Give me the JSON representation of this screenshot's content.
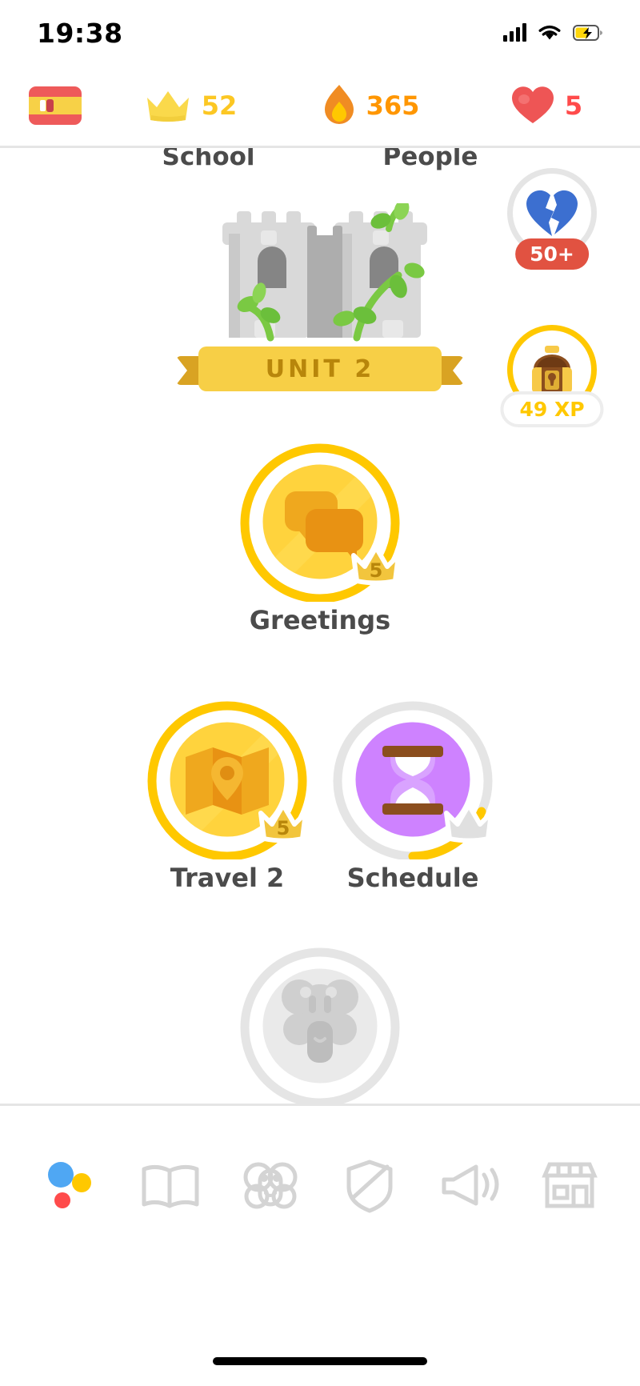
{
  "status_bar": {
    "time": "19:38",
    "icons": [
      "cellular-signal-icon",
      "wifi-icon",
      "battery-charging-icon"
    ]
  },
  "top_bar": {
    "course_flag": {
      "name": "spanish-flag-icon",
      "language": "Spanish"
    },
    "crown": {
      "icon": "crown-icon",
      "value": "52",
      "color": "#FCC723"
    },
    "streak": {
      "icon": "flame-icon",
      "value": "365",
      "color": "#FF9600"
    },
    "hearts": {
      "icon": "heart-icon",
      "value": "5",
      "color": "#FF4B4B"
    }
  },
  "tabs_cut_off": [
    {
      "label": "School"
    },
    {
      "label": "People"
    }
  ],
  "unit_header": {
    "illustration": "castle-icon",
    "banner_label": "UNIT 2"
  },
  "right_rail": [
    {
      "name": "streak-repair-button",
      "icon": "broken-heart-icon",
      "icon_color": "#3C6FD0",
      "badge": "50+",
      "badge_color": "#E15241",
      "ring_color": "#E5E5E5"
    },
    {
      "name": "treasure-chest-button",
      "icon": "treasure-chest-icon",
      "badge": "49 XP",
      "badge_color": "#FFC800",
      "ring_color": "#FFC800"
    }
  ],
  "lesson_nodes": [
    {
      "name": "lesson-greetings",
      "label": "Greetings",
      "icon": "chat-bubbles-icon",
      "state": "completed-gold",
      "crown_level": "5",
      "ring_color": "#FFC800",
      "fill_color": "#FFD33D"
    },
    {
      "name": "lesson-travel-2",
      "label": "Travel 2",
      "icon": "map-pin-icon",
      "state": "completed-gold",
      "crown_level": "5",
      "ring_color": "#FFC800",
      "fill_color": "#FFD33D"
    },
    {
      "name": "lesson-schedule",
      "label": "Schedule",
      "icon": "hourglass-icon",
      "state": "in-progress",
      "crown_level": "",
      "ring_color": "#E5E5E5",
      "progress_color": "#FFC800",
      "fill_color": "#CE82FF"
    },
    {
      "name": "lesson-locked",
      "label": "",
      "icon": "duo-character-icon",
      "state": "locked",
      "crown_level": "",
      "ring_color": "#E5E5E5",
      "fill_color": "#E5E5E5"
    }
  ],
  "bottom_nav": [
    {
      "name": "nav-learn",
      "icon": "duolingo-dots-icon",
      "active": true
    },
    {
      "name": "nav-practice",
      "icon": "book-icon",
      "active": false
    },
    {
      "name": "nav-characters",
      "icon": "duo-head-icon",
      "active": false
    },
    {
      "name": "nav-leagues",
      "icon": "shield-icon",
      "active": false
    },
    {
      "name": "nav-quests",
      "icon": "megaphone-icon",
      "active": false
    },
    {
      "name": "nav-shop",
      "icon": "shop-icon",
      "active": false
    }
  ],
  "colors": {
    "gold": "#FFC800",
    "gold_fill": "#FFD33D",
    "purple": "#CE82FF",
    "red": "#FF4B4B",
    "orange": "#FF9600",
    "gray": "#E5E5E5",
    "text": "#4B4B4B"
  }
}
